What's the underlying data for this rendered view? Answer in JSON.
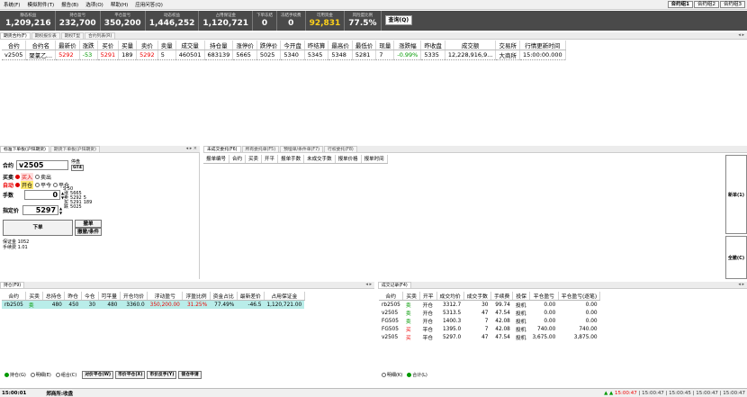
{
  "menu": [
    "系统(F)",
    "模拟附件(T)",
    "报告(B)",
    "选项(O)",
    "帮助(H)",
    "应用问答(Q)"
  ],
  "accounts": [
    "合约组1",
    "合约组2",
    "合约组3"
  ],
  "summary": [
    {
      "label": "静态权益",
      "value": "1,209,216"
    },
    {
      "label": "持仓盈亏",
      "value": "232,700"
    },
    {
      "label": "平仓盈亏",
      "value": "350,200"
    },
    {
      "label": "动态权益",
      "value": "1,446,252"
    },
    {
      "label": "占用保证金",
      "value": "1,120,721"
    },
    {
      "label": "下单冻结",
      "value": "0"
    },
    {
      "label": "冻结手续费",
      "value": "0"
    },
    {
      "label": "可用资金",
      "value": "92,831"
    },
    {
      "label": "风险度比例",
      "value": "77.5%"
    }
  ],
  "query_label": "查询(Q)",
  "quote_tabs": [
    "期货合约(F)",
    "期权报价表",
    "期权T型",
    "合约列表(R)"
  ],
  "quote_headers": [
    "合约",
    "合约名",
    "最新价",
    "涨跌",
    "买价",
    "买量",
    "卖价",
    "卖量",
    "成交量",
    "持仓量",
    "涨停价",
    "跌停价",
    "今开盘",
    "昨结算",
    "最高价",
    "最低价",
    "现量",
    "涨跌幅",
    "昨收盘",
    "成交额",
    "交易所",
    "行情更新时间"
  ],
  "quote_row": [
    "v2505",
    "聚氯乙...",
    "5292",
    "-53",
    "5291",
    "189",
    "5292",
    "5",
    "460501",
    "683139",
    "5665",
    "5025",
    "5340",
    "5345",
    "5348",
    "5281",
    "7",
    "-0.99%",
    "5335",
    "12,228,916,9...",
    "大商所",
    "15:00:00.000"
  ],
  "order_tabs": [
    "标准下单板(沪锌期货)",
    "期货下单板(沪锌期货)"
  ],
  "order": {
    "contract_label": "合约",
    "contract": "v2505",
    "lock_label": "停盘",
    "gt_label": "GT4",
    "side_label": "买卖",
    "buy": "买入",
    "sell": "卖出",
    "auto_label": "自动",
    "open": "开仓",
    "close_today": "平今",
    "close": "平仓",
    "qty_label": "手数",
    "qty": "0",
    "price_label": "指定价",
    "price": "5297",
    "ladder": [
      {
        "k": "涨",
        "v": "5665",
        "q": ""
      },
      {
        "k": "卖",
        "v": "5292",
        "q": "5"
      },
      {
        "k": "买",
        "v": "5291",
        "q": "189"
      },
      {
        "k": "跌",
        "v": "5025",
        "q": ""
      }
    ],
    "ladder_top": "S 50",
    "order_btn": "下单",
    "cancel_btn": "撤单",
    "cond_btn": "撤撤/条件",
    "margin_label": "保证金",
    "margin": "1052",
    "fee_label": "手续费",
    "fee": "1.01"
  },
  "pending_tabs": [
    "未成交委托(F6)",
    "所有委托单(F5)",
    "预埋单/条件单(F7)",
    "行权委托(F8)"
  ],
  "pending_headers": [
    "报单编号",
    "合约",
    "买卖",
    "开平",
    "报单手数",
    "未成交手数",
    "报单价格",
    "报单时间"
  ],
  "side_btn_new": "新单(1)",
  "side_btn_all": "全撤(C)",
  "positions_tab": "持仓(F9)",
  "pos_headers": [
    "合约",
    "买卖",
    "总持仓",
    "昨仓",
    "今仓",
    "可平量",
    "开仓均价",
    "浮动盈亏",
    "浮盈比例",
    "资金占比",
    "最新差价",
    "占用保证金"
  ],
  "pos_rows": [
    [
      "rb2505",
      "卖",
      "480",
      "450",
      "30",
      "480",
      "3360.0",
      "350,200.00",
      "31.25%",
      "77.49%",
      "-46.5",
      "1,120,721.00"
    ]
  ],
  "trades_tab": "成交记录(F4)",
  "trade_headers": [
    "合约",
    "买卖",
    "开平",
    "成交均价",
    "成交手数",
    "手续费",
    "投保",
    "平仓盈亏",
    "平仓盈亏(逐笔)"
  ],
  "trade_rows": [
    [
      "rb2505",
      "卖",
      "开仓",
      "3312.7",
      "30",
      "99.74",
      "投机",
      "0.00",
      "0.00"
    ],
    [
      "v2505",
      "卖",
      "开仓",
      "5313.5",
      "47",
      "47.54",
      "投机",
      "0.00",
      "0.00"
    ],
    [
      "FG505",
      "卖",
      "开仓",
      "1400.3",
      "7",
      "42.08",
      "投机",
      "0.00",
      "0.00"
    ],
    [
      "FG505",
      "买",
      "平仓",
      "1395.0",
      "7",
      "42.08",
      "投机",
      "740.00",
      "740.00"
    ],
    [
      "v2505",
      "买",
      "平仓",
      "5297.0",
      "47",
      "47.54",
      "投机",
      "3,675.00",
      "3,875.00"
    ]
  ],
  "pos_filters": [
    "持仓(G)",
    "明细(E)",
    "组合(C)"
  ],
  "pos_buttons": [
    "对价平仓(W)",
    "市价平仓(X)",
    "市价反手(Y)",
    "锁仓申请"
  ],
  "trade_filters": [
    "明细(K)",
    "合计(L)"
  ],
  "status_left": "15:00:01",
  "status_exchange": "郑商所:收盘",
  "status_times": [
    "15:00:47",
    "15:00:47",
    "15:00:45",
    "15:00:47",
    "15:00:47"
  ]
}
